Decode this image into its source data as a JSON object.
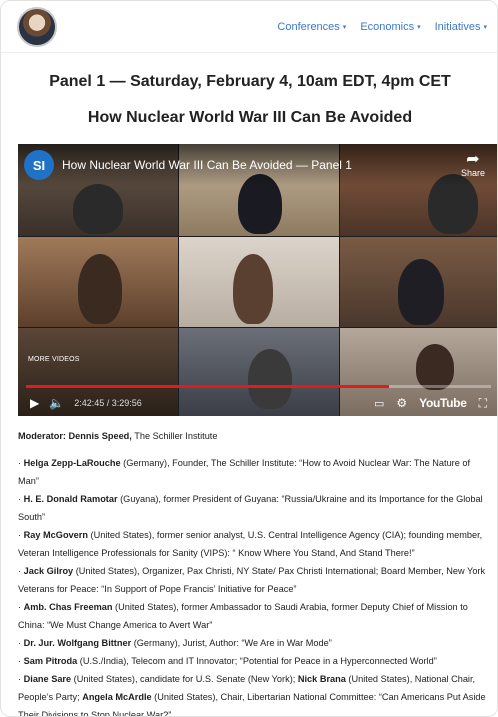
{
  "nav": {
    "items": [
      {
        "label": "Conferences"
      },
      {
        "label": "Economics"
      },
      {
        "label": "Initiatives"
      }
    ]
  },
  "headings": {
    "panel": "Panel 1 — Saturday, February 4, 10am EDT, 4pm CET",
    "title": "How Nuclear World War III Can Be Avoided"
  },
  "video": {
    "channel_logo": "SI",
    "title": "How Nuclear World War III Can Be Avoided — Panel 1",
    "share": "Share",
    "more_videos": "MORE VIDEOS",
    "time": "2:42:45 / 3:29:56",
    "progress": 0.78,
    "brand": "YouTube",
    "icons": [
      "play-icon",
      "volume-icon",
      "captions-icon",
      "settings-icon",
      "fullscreen-icon",
      "share-icon"
    ]
  },
  "moderator": {
    "name": "Moderator: Dennis Speed,",
    "org": " The Schiller Institute"
  },
  "speakers": [
    {
      "pre": "· ",
      "name": "Helga Zepp-LaRouche",
      "rest": " (Germany), Founder, The Schiller Institute: “How to Avoid Nuclear War: The Nature of Man”"
    },
    {
      "pre": "· ",
      "name": "H. E. Donald Ramotar",
      "rest": " (Guyana), former President of Guyana: “Russia/Ukraine and its Importance for the Global South”"
    },
    {
      "pre": "· ",
      "name": "Ray McGovern",
      "rest": " (United States), former senior analyst, U.S. Central Intelligence Agency (CIA); founding member, Veteran Intelligence Professionals for Sanity (VIPS): “ Know Where You Stand, And Stand There!”"
    },
    {
      "pre": "· ",
      "name": "Jack Gilroy",
      "rest": " (United States), Organizer, Pax Christi, NY State/ Pax Christi International; Board Member, New York Veterans for Peace: “In Support of Pope Francis’ Initiative for Peace”"
    },
    {
      "pre": "· ",
      "name": "Amb. Chas Freeman",
      "rest": " (United States), former Ambassador  to Saudi Arabia, former Deputy Chief of Mission to China: “We Must Change America to Avert War”"
    },
    {
      "pre": "· ",
      "name": "Dr. Jur. Wolfgang Bittner",
      "rest": " (Germany), Jurist, Author: “We Are in War Mode”"
    },
    {
      "pre": "· ",
      "name": "Sam Pitroda",
      "rest": " (U.S./India), Telecom and IT Innovator; “Potential for Peace in a Hyperconnected World”"
    },
    {
      "pre": "· ",
      "name": "Diane Sare",
      "rest": " (United States), candidate for U.S. Senate (New York); ",
      "name2": "Nick Brana",
      "rest2": " (United States), National Chair, People’s Party; ",
      "name3": "Angela McArdle",
      "rest3": " (United States), Chair, Libertarian National Committee: “Can Americans Put Aside Their Divisions to Stop Nuclear War?”"
    }
  ]
}
